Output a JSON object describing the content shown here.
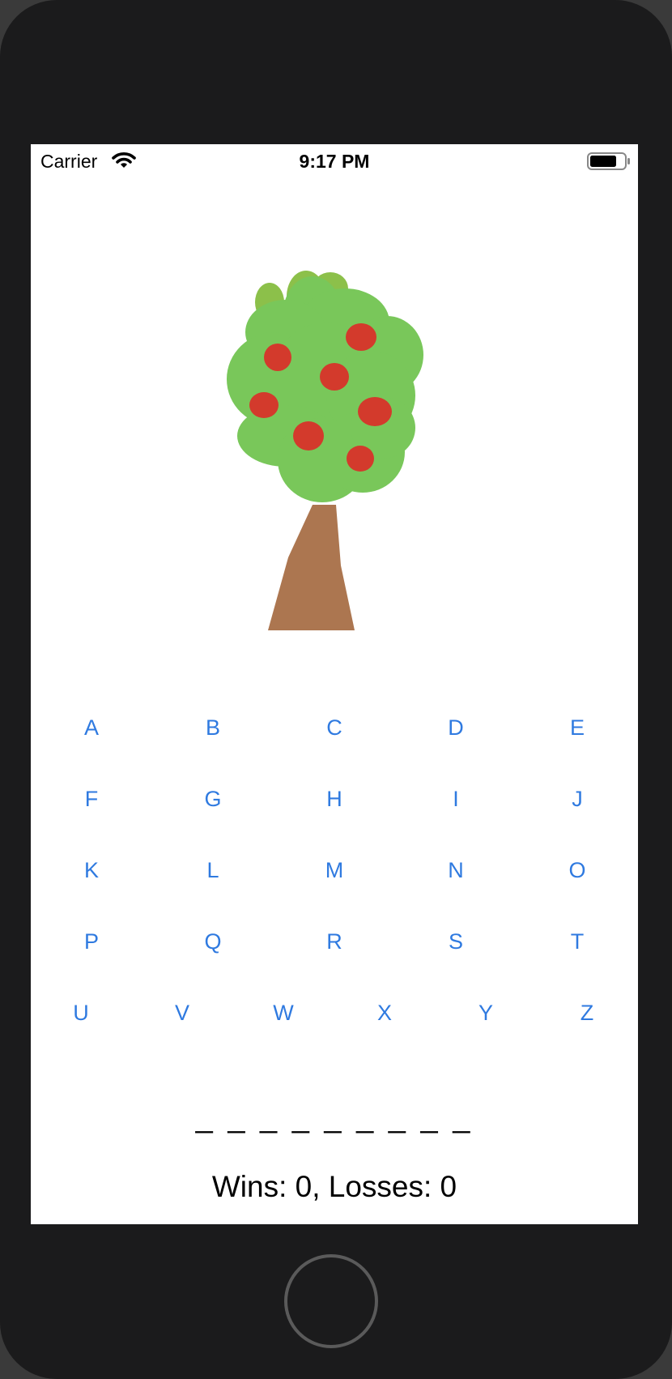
{
  "status_bar": {
    "carrier": "Carrier",
    "time": "9:17 PM",
    "icons": [
      "wifi-icon",
      "battery-icon"
    ]
  },
  "illustration": {
    "name": "apple-tree",
    "apple_count": 7,
    "colors": {
      "leaves": "#79c75a",
      "apples": "#d33a2c",
      "trunk": "#ac7650"
    }
  },
  "letters": {
    "rows": [
      [
        "A",
        "B",
        "C",
        "D",
        "E"
      ],
      [
        "F",
        "G",
        "H",
        "I",
        "J"
      ],
      [
        "K",
        "L",
        "M",
        "N",
        "O"
      ],
      [
        "P",
        "Q",
        "R",
        "S",
        "T"
      ],
      [
        "U",
        "V",
        "W",
        "X",
        "Y",
        "Z"
      ]
    ],
    "color": "#2f7ae0"
  },
  "word_display": "_ _ _ _ _ _ _ _ _",
  "score_label": "Wins: 0, Losses: 0"
}
